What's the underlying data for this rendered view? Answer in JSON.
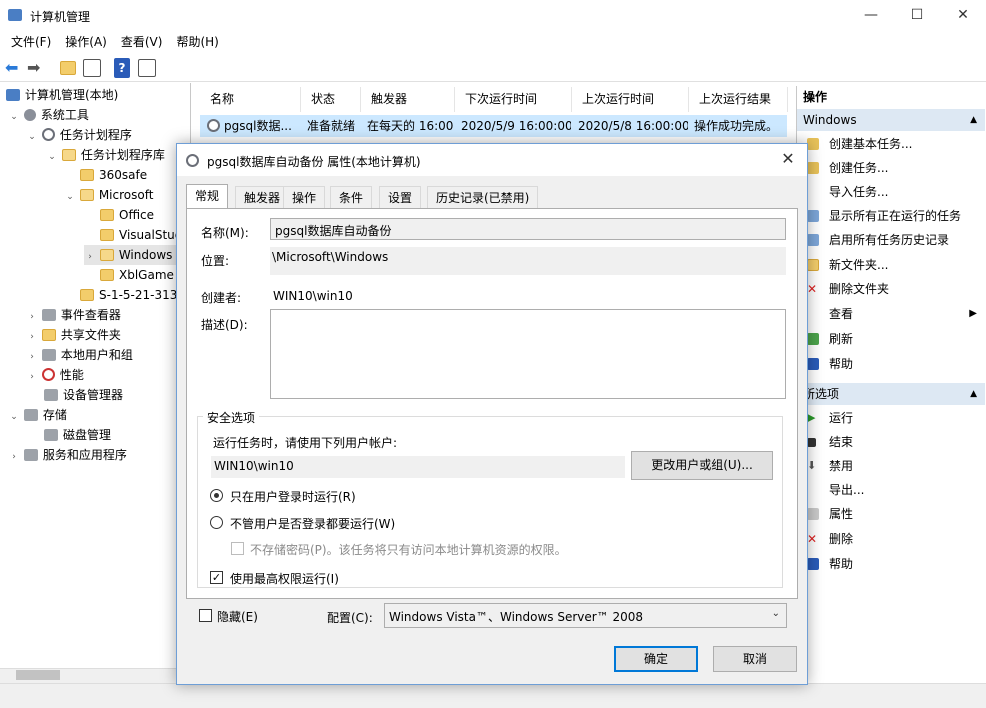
{
  "window": {
    "title": "计算机管理",
    "controls": {
      "minimize": "—",
      "maximize": "☐",
      "close": "✕"
    }
  },
  "menu": [
    "文件(F)",
    "操作(A)",
    "查看(V)",
    "帮助(H)"
  ],
  "tree": {
    "root": "计算机管理(本地)",
    "items": [
      {
        "label": "系统工具"
      },
      {
        "label": "任务计划程序"
      },
      {
        "label": "任务计划程序库"
      },
      {
        "label": "360safe"
      },
      {
        "label": "Microsoft"
      },
      {
        "label": "Office"
      },
      {
        "label": "VisualStud"
      },
      {
        "label": "Windows"
      },
      {
        "label": "XblGame"
      },
      {
        "label": "S-1-5-21-313"
      },
      {
        "label": "事件查看器"
      },
      {
        "label": "共享文件夹"
      },
      {
        "label": "本地用户和组"
      },
      {
        "label": "性能"
      },
      {
        "label": "设备管理器"
      },
      {
        "label": "存储"
      },
      {
        "label": "磁盘管理"
      },
      {
        "label": "服务和应用程序"
      }
    ]
  },
  "task_list": {
    "columns": [
      "名称",
      "状态",
      "触发器",
      "下次运行时间",
      "上次运行时间",
      "上次运行结果"
    ],
    "row": [
      "pgsql数据...",
      "准备就绪",
      "在每天的 16:00",
      "2020/5/9 16:00:00",
      "2020/5/8 16:00:00",
      "操作成功完成。"
    ]
  },
  "actions": {
    "header": "操作",
    "section1": "Windows",
    "items1": [
      "创建基本任务...",
      "创建任务...",
      "导入任务...",
      "显示所有正在运行的任务",
      "启用所有任务历史记录",
      "新文件夹...",
      "删除文件夹",
      "查看",
      "刷新",
      "帮助"
    ],
    "section2": "所选项",
    "items2": [
      "运行",
      "结束",
      "禁用",
      "导出...",
      "属性",
      "删除",
      "帮助"
    ]
  },
  "dialog": {
    "title": "pgsql数据库自动备份 属性(本地计算机)",
    "close": "✕",
    "tabs": [
      "常规",
      "触发器",
      "操作",
      "条件",
      "设置",
      "历史记录(已禁用)"
    ],
    "name_label": "名称(M):",
    "name_value": "pgsql数据库自动备份",
    "location_label": "位置:",
    "location_value": "\\Microsoft\\Windows",
    "author_label": "创建者:",
    "author_value": "WIN10\\win10",
    "description_label": "描述(D):",
    "security_group": "安全选项",
    "run_as_prompt": "运行任务时，请使用下列用户帐户:",
    "run_as_user": "WIN10\\win10",
    "change_user_button": "更改用户或组(U)...",
    "radio_logged_on": "只在用户登录时运行(R)",
    "radio_any": "不管用户是否登录都要运行(W)",
    "no_store_password": "不存储密码(P)。该任务将只有访问本地计算机资源的权限。",
    "highest_privileges": "使用最高权限运行(I)",
    "hidden_label": "隐藏(E)",
    "config_label": "配置(C):",
    "config_value": "Windows Vista™、Windows Server™ 2008",
    "ok_button": "确定",
    "cancel_button": "取消"
  }
}
